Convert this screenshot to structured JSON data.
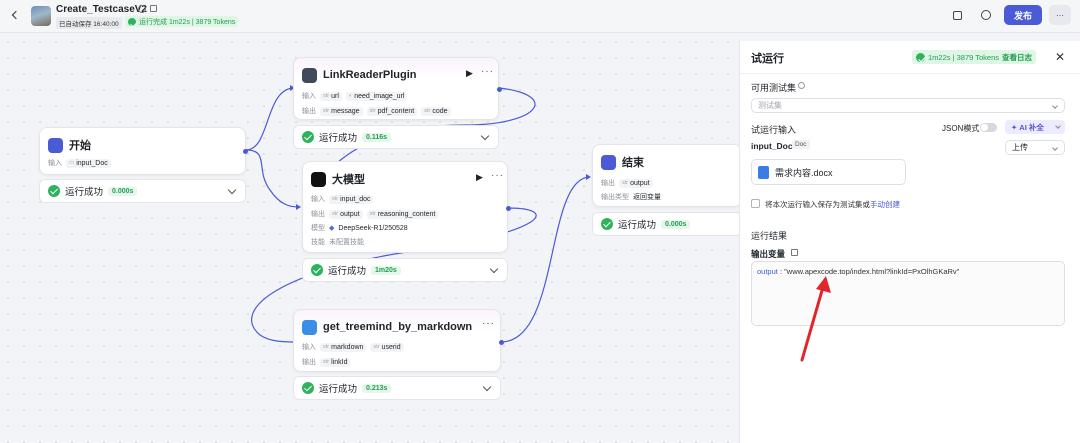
{
  "header": {
    "title": "Create_TestcaseV2",
    "autosave": "已自动保存 16:40:00",
    "run_status": "运行完成 1m22s | 3879 Tokens",
    "publish_label": "发布",
    "more_label": "···"
  },
  "nodes": {
    "start": {
      "title": "开始",
      "input_label": "输入",
      "input_value": "input_Doc",
      "status": "运行成功",
      "time": "0.000s"
    },
    "linkreader": {
      "title": "LinkReaderPlugin",
      "input_label": "输入",
      "inputs": [
        "url",
        "need_image_url"
      ],
      "output_label": "输出",
      "outputs": [
        "message",
        "pdf_content",
        "code"
      ],
      "status": "运行成功",
      "time": "0.116s"
    },
    "llm": {
      "title": "大模型",
      "input_label": "输入",
      "inputs": [
        "input_doc"
      ],
      "output_label": "输出",
      "outputs": [
        "output",
        "reasoning_content"
      ],
      "model_label": "模型",
      "model_value": "DeepSeek-R1/250528",
      "skill_label": "技能",
      "skill_value": "未配置技能",
      "status": "运行成功",
      "time": "1m20s"
    },
    "treemind": {
      "title": "get_treemind_by_markdown",
      "input_label": "输入",
      "inputs": [
        "markdown",
        "userid"
      ],
      "output_label": "输出",
      "outputs": [
        "linkId"
      ],
      "status": "运行成功",
      "time": "0.213s"
    },
    "end": {
      "title": "结束",
      "output_label": "输出",
      "output_value": "output",
      "outtype_label": "输出类型",
      "outtype_value": "返回变量",
      "status": "运行成功",
      "time": "0.000s"
    }
  },
  "type_tag": "str",
  "panel": {
    "title": "试运行",
    "badge": "1m22s | 3879 Tokens",
    "view_log": "查看日志",
    "testset_label": "可用测试集",
    "testset_placeholder": "测试集",
    "run_input_label": "试运行输入",
    "json_mode_label": "JSON模式",
    "ai_fill_label": "AI 补全",
    "input_doc_label": "input_Doc",
    "doc_tag": "Doc",
    "upload_label": "上传",
    "file_name": "需求内容.docx",
    "save_text": "将本次运行输入保存为测试集或",
    "manual_create": "手动创建",
    "result_label": "运行结果",
    "output_var_label": "输出变量",
    "output_key": "output",
    "output_value": "\"www.apexcode.top/index.html?linkId=PxOlhGKaRv\""
  },
  "colors": {
    "accent": "#4b5bd6",
    "success": "#2eb35d",
    "arrow": "#e0262b"
  }
}
